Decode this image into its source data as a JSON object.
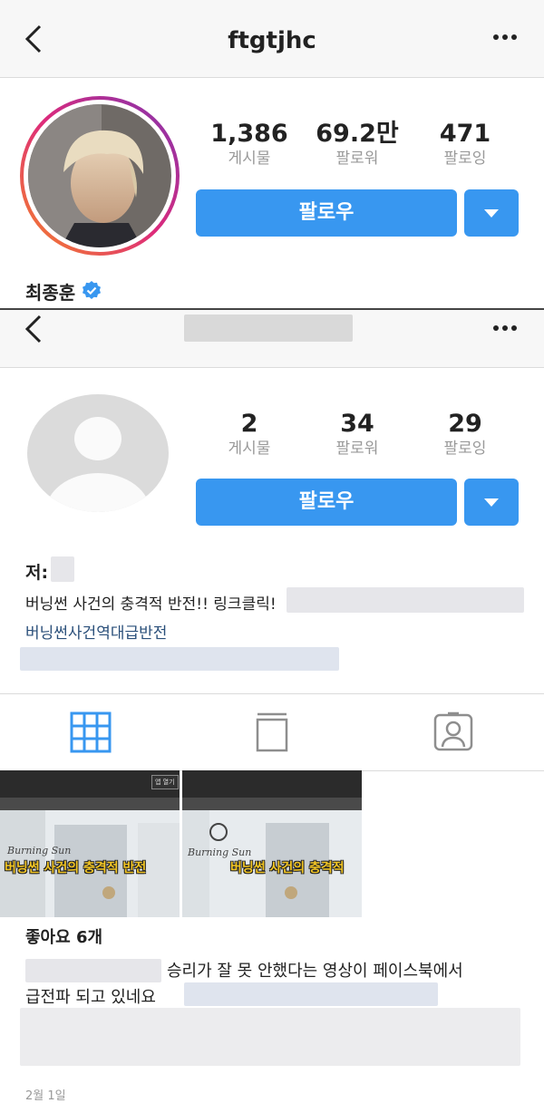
{
  "top_profile": {
    "username": "ftgtjhc",
    "stats": [
      {
        "value": "1,386",
        "label": "게시물"
      },
      {
        "value": "69.2만",
        "label": "팔로워"
      },
      {
        "value": "471",
        "label": "팔로잉"
      }
    ],
    "follow_label": "팔로우",
    "display_name": "최종훈",
    "verified": true
  },
  "bottom_profile": {
    "stats": [
      {
        "value": "2",
        "label": "게시물"
      },
      {
        "value": "34",
        "label": "팔로워"
      },
      {
        "value": "29",
        "label": "팔로잉"
      }
    ],
    "follow_label": "팔로우",
    "name_prefix": "저:",
    "bio_line": "버닝썬 사건의 충격적 반전!! 링크클릭!",
    "hashtag": "버닝썬사건역대급반전"
  },
  "tabs": [
    "grid-icon",
    "feed-icon",
    "tagged-icon"
  ],
  "posts": [
    {
      "caption": "버닝썬 사건의 충격적 반전",
      "badge": "앱 열기",
      "sign": "Burning Sun"
    },
    {
      "caption": "버닝썬 사건의 충격적",
      "sign": "Burning Sun"
    }
  ],
  "post_detail": {
    "likes": "좋아요 6개",
    "caption_line1": "승리가 잘 못 안했다는 영상이 페이스북에서",
    "caption_line2": "급전파 되고 있네요",
    "date": "2월 1일"
  },
  "colors": {
    "accent": "#3897f0",
    "link": "#2a4f7a",
    "verified": "#3897f0"
  }
}
